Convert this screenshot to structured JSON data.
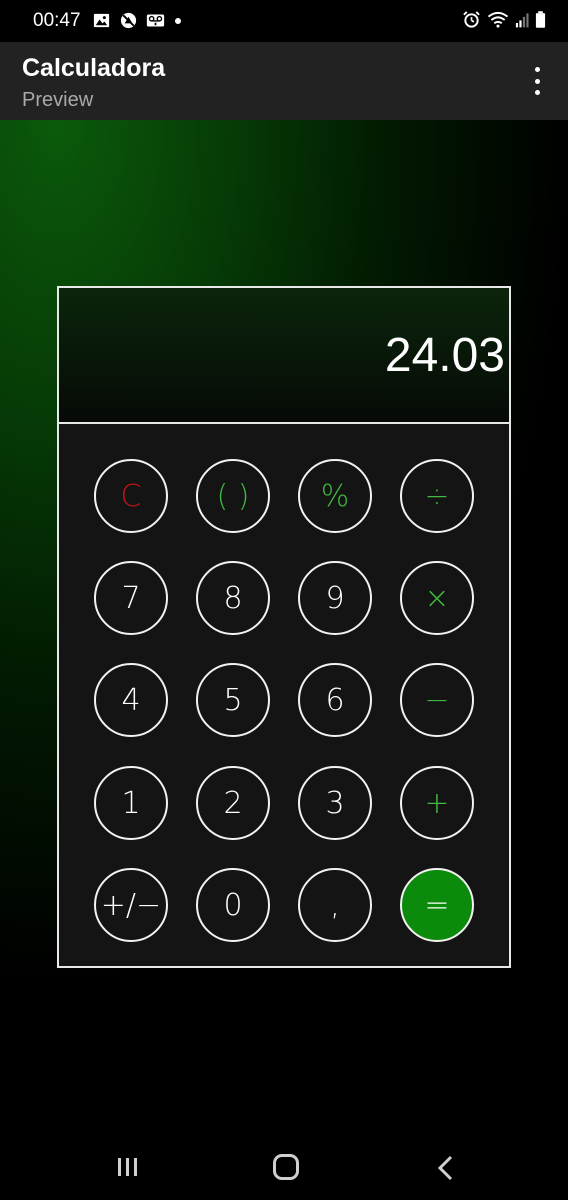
{
  "status_bar": {
    "time": "00:47",
    "left_icons": [
      "image-icon",
      "no-disturb-icon",
      "voicemail-icon"
    ],
    "right_icons": [
      "alarm-icon",
      "wifi-icon",
      "signal-icon",
      "battery-icon"
    ]
  },
  "app_bar": {
    "title": "Calculadora",
    "subtitle": "Preview",
    "menu_icon": "more-vert-icon"
  },
  "calculator": {
    "display_value": "24.03",
    "keys": [
      {
        "label": "C",
        "style": "red"
      },
      {
        "label": "( )",
        "style": "green"
      },
      {
        "label": "%",
        "style": "green"
      },
      {
        "label": "÷",
        "style": "green"
      },
      {
        "label": "7",
        "style": "white"
      },
      {
        "label": "8",
        "style": "white"
      },
      {
        "label": "9",
        "style": "white"
      },
      {
        "label": "×",
        "style": "green"
      },
      {
        "label": "4",
        "style": "white"
      },
      {
        "label": "5",
        "style": "white"
      },
      {
        "label": "6",
        "style": "white"
      },
      {
        "label": "−",
        "style": "green"
      },
      {
        "label": "1",
        "style": "white"
      },
      {
        "label": "2",
        "style": "white"
      },
      {
        "label": "3",
        "style": "white"
      },
      {
        "label": "+",
        "style": "green"
      },
      {
        "label": "+/−",
        "style": "white"
      },
      {
        "label": "0",
        "style": "white"
      },
      {
        "label": ",",
        "style": "white"
      },
      {
        "label": "=",
        "style": "equals"
      }
    ]
  },
  "colors": {
    "accent_green": "#3fb83f",
    "equals_fill": "#0b8a0b",
    "clear_red": "#c01515",
    "app_bar": "#222222"
  },
  "nav_bar": {
    "icons": [
      "recent-apps-icon",
      "home-icon",
      "back-icon"
    ]
  }
}
